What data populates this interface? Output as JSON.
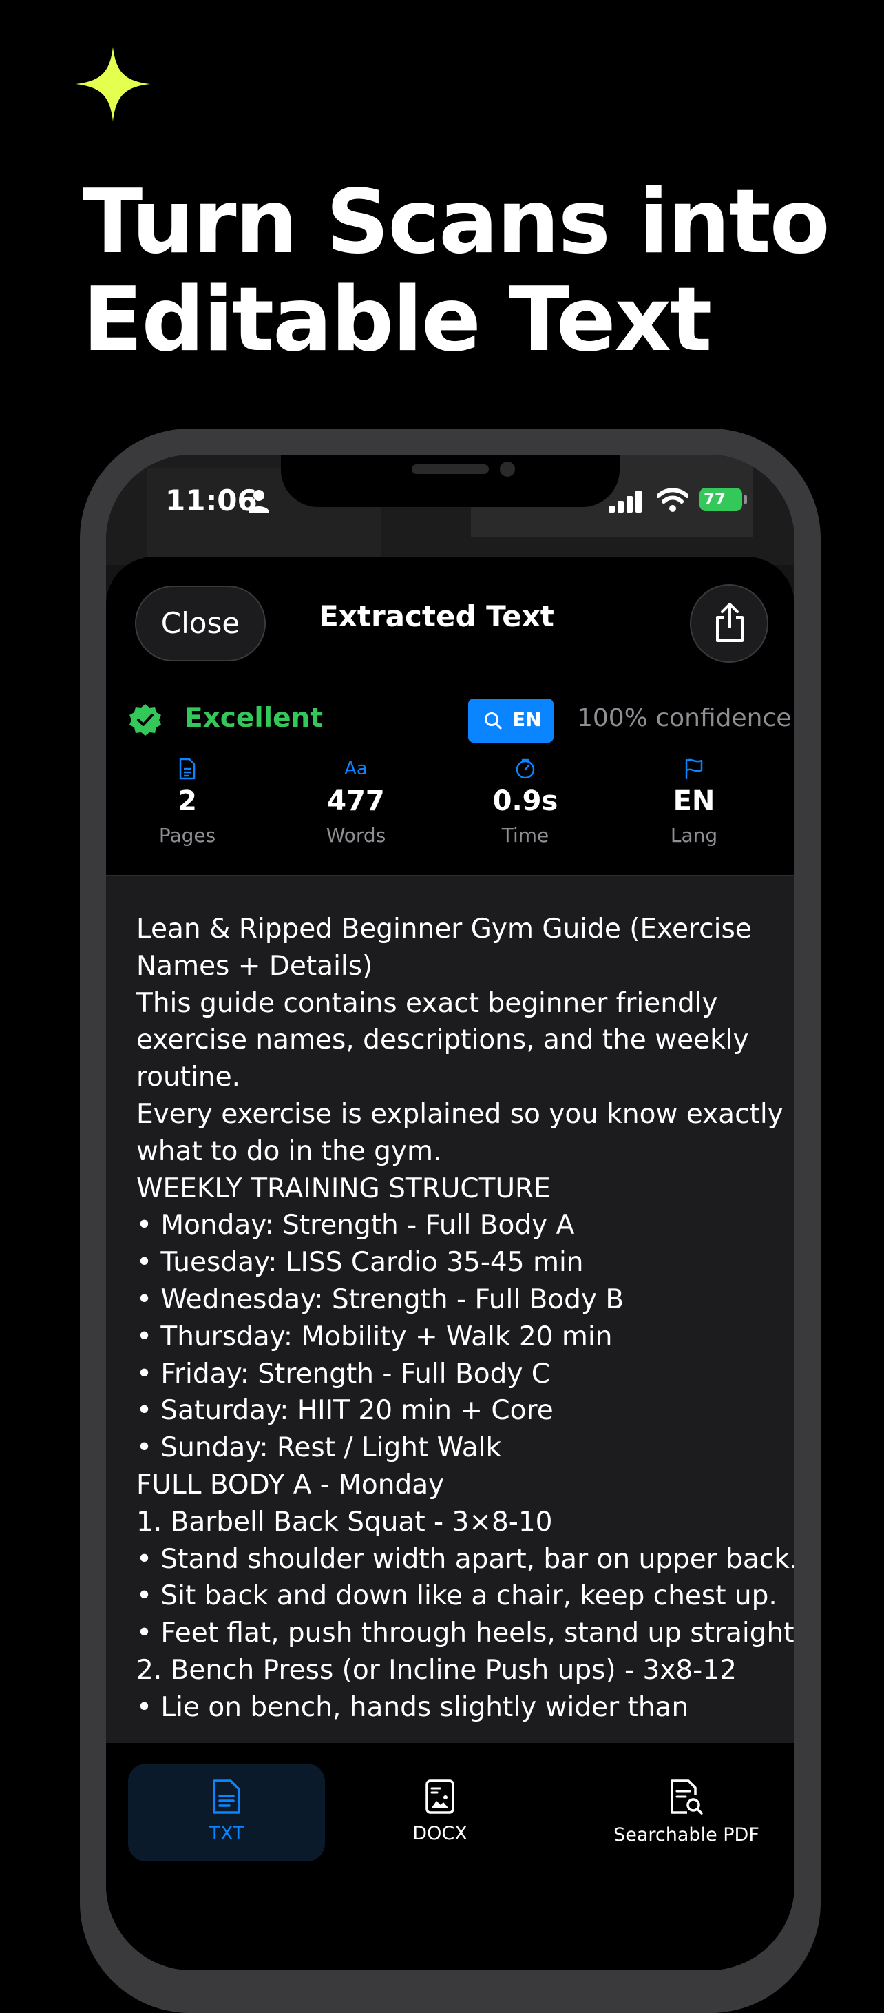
{
  "headline": {
    "line1": "Turn Scans into",
    "line2": "Editable Text"
  },
  "status_bar": {
    "time": "11:06",
    "battery": "77"
  },
  "sheet": {
    "close_label": "Close",
    "title": "Extracted Text"
  },
  "quality": {
    "label": "Excellent",
    "language_chip": "EN",
    "confidence": "100% confidence"
  },
  "stats": [
    {
      "icon": "document-icon",
      "value": "2",
      "label": "Pages"
    },
    {
      "icon": "font-icon",
      "glyph": "Aa",
      "value": "477",
      "label": "Words"
    },
    {
      "icon": "timer-icon",
      "value": "0.9s",
      "label": "Time"
    },
    {
      "icon": "flag-icon",
      "value": "EN",
      "label": "Lang"
    }
  ],
  "extracted_lines": [
    "Lean & Ripped Beginner Gym Guide (Exercise",
    "Names + Details)",
    "This guide contains exact beginner friendly",
    "exercise names, descriptions, and the weekly",
    "routine.",
    "Every exercise is explained so you know exactly",
    "what to do in the gym.",
    "WEEKLY TRAINING STRUCTURE",
    "• Monday: Strength - Full Body A",
    "• Tuesday: LISS Cardio 35-45 min",
    "• Wednesday: Strength - Full Body B",
    "• Thursday: Mobility + Walk 20 min",
    "• Friday: Strength - Full Body C",
    "• Saturday: HIIT 20 min + Core",
    "• Sunday: Rest / Light Walk",
    "FULL BODY A - Monday",
    "1. Barbell Back Squat - 3×8-10",
    "• Stand shoulder width apart, bar on upper back.",
    "• Sit back and down like a chair, keep chest up.",
    "• Feet flat, push through heels, stand up straight.",
    "2. Bench Press (or Incline Push ups) - 3x8-12",
    "• Lie on bench, hands slightly wider than"
  ],
  "tabs": [
    {
      "label": "TXT",
      "active": true
    },
    {
      "label": "DOCX",
      "active": false
    },
    {
      "label": "Searchable PDF",
      "active": false
    }
  ],
  "colors": {
    "accent": "#0a84ff",
    "success": "#34c759",
    "sparkle": "#e4ff4d",
    "background": "#000000"
  }
}
